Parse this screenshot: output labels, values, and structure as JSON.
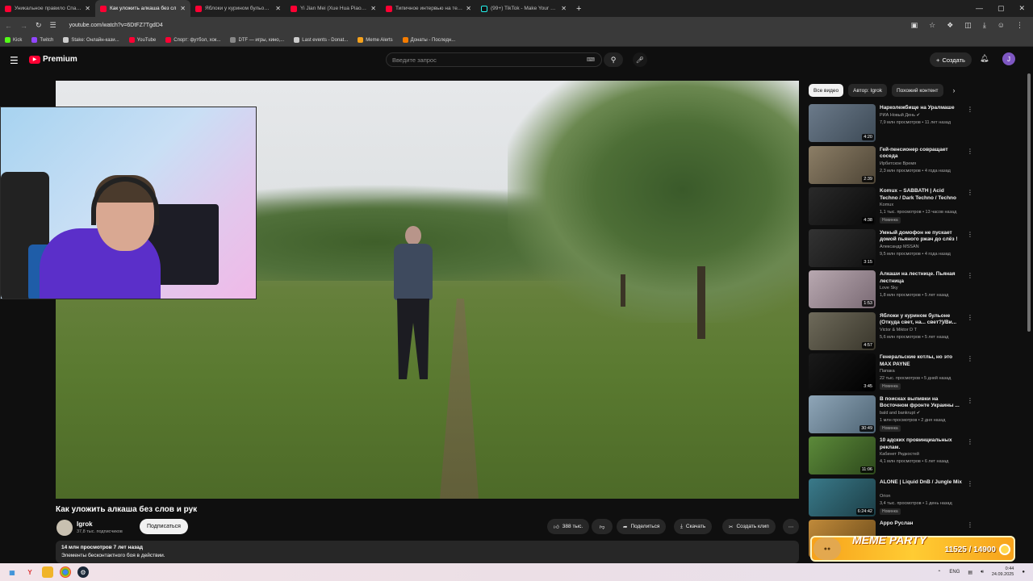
{
  "browser": {
    "tabs": [
      {
        "title": "Уникальное правило Спанч Б",
        "active": false,
        "icon": "youtube"
      },
      {
        "title": "Как уложить алкаша без сл",
        "active": true,
        "icon": "youtube"
      },
      {
        "title": "Яблоки у курином бульоне (О",
        "active": false,
        "icon": "youtube"
      },
      {
        "title": "Yi Jian Mei (Xue Hua Piao Piao)",
        "active": false,
        "icon": "youtube"
      },
      {
        "title": "Типичное интервью на телеви",
        "active": false,
        "icon": "youtube"
      },
      {
        "title": "(99+) TikTok - Make Your Day",
        "active": false,
        "icon": "tiktok"
      }
    ],
    "new_tab": "+",
    "url": "youtube.com/watch?v=6DtFZ7TgdD4",
    "bookmarks": [
      {
        "label": "Kick",
        "color": "#53fc18"
      },
      {
        "label": "Twitch",
        "color": "#9146ff"
      },
      {
        "label": "Stake: Онлайн-кази...",
        "color": "#cccccc"
      },
      {
        "label": "YouTube",
        "color": "#ff0033"
      },
      {
        "label": "Спорт: футбол, хок...",
        "color": "#ff0033"
      },
      {
        "label": "DTF — игры, кино,...",
        "color": "#888888"
      },
      {
        "label": "Last events - Donat...",
        "color": "#cccccc"
      },
      {
        "label": "Meme Alerts",
        "color": "#f7a21b"
      },
      {
        "label": "Донаты - Последн...",
        "color": "#f57c00"
      }
    ]
  },
  "header": {
    "logo_text": "Premium",
    "search_placeholder": "Введите запрос",
    "create_label": "Создать",
    "avatar_letter": "J"
  },
  "video": {
    "title": "Как уложить алкаша без слов и рук",
    "channel": "Igrok",
    "subscribers": "37,8 тыс. подписчиков",
    "subscribe_label": "Подписаться",
    "likes": "388 тыс.",
    "share_label": "Поделиться",
    "download_label": "Скачать",
    "clip_label": "Создать клип",
    "stats": "14 млн просмотров  7 лет назад",
    "description": "Элементы бесконтактного боя в действии."
  },
  "chips": [
    "Все видео",
    "Автор: Igrok",
    "Похожий контент"
  ],
  "recommendations": [
    {
      "title": "Нарколежбище на Уралмаше",
      "channel": "РИА Новый День",
      "verified": true,
      "meta": "7,9 млн просмотров • 11 лет назад",
      "duration": "4:20",
      "badge": "",
      "c1": "#6b7a8a",
      "c2": "#3d4a56"
    },
    {
      "title": "Гей-пенсионер совращает соседа",
      "channel": "Ирбитское Время",
      "verified": false,
      "meta": "2,3 млн просмотров • 4 года назад",
      "duration": "2:39",
      "badge": "",
      "c1": "#8c7e66",
      "c2": "#4e4536"
    },
    {
      "title": "Komux – SABBATH | Acid Techno / Dark Techno / Techno",
      "channel": "Komux",
      "verified": false,
      "meta": "1,1 тыс. просмотров • 13 часов назад",
      "duration": "4:38",
      "badge": "Новинка",
      "c1": "#2a2a2a",
      "c2": "#0a0a0a"
    },
    {
      "title": "Умный домофон не пускает домой пьяного ржач до слёз !",
      "channel": "Александр MSSAN",
      "verified": false,
      "meta": "9,5 млн просмотров • 4 года назад",
      "duration": "3:15",
      "badge": "",
      "c1": "#333333",
      "c2": "#111111"
    },
    {
      "title": "Алкаши на лестнице. Пьяная лестница",
      "channel": "Love Sky",
      "verified": false,
      "meta": "1,8 млн просмотров • 5 лет назад",
      "duration": "1:53",
      "badge": "",
      "c1": "#b8a8b0",
      "c2": "#7a6a74"
    },
    {
      "title": "Яблоки у курином бульоне (Откуда свет, на... свет?)/Ви...",
      "channel": "Victor & Miktor D T",
      "verified": false,
      "meta": "5,6 млн просмотров • 5 лет назад",
      "duration": "4:57",
      "badge": "",
      "c1": "#6e6a5a",
      "c2": "#3a372c"
    },
    {
      "title": "Генеральские котлы, но это MAX PAYNE",
      "channel": "Папака",
      "verified": false,
      "meta": "22 тыс. просмотров • 5 дней назад",
      "duration": "3:45",
      "badge": "Новинка",
      "c1": "#1a1a1a",
      "c2": "#000000"
    },
    {
      "title": "В поисках выпивки на Восточном фронте Украины ...",
      "channel": "bald and bankrupt",
      "verified": true,
      "meta": "1 млн просмотров • 2 дня назад",
      "duration": "30:49",
      "badge": "Новинка",
      "c1": "#8fa6b8",
      "c2": "#4e6474"
    },
    {
      "title": "10 адских провинциальных реклам.",
      "channel": "Кабинет Редкостей",
      "verified": false,
      "meta": "4,1 млн просмотров • 6 лет назад",
      "duration": "11:06",
      "badge": "",
      "c1": "#5c8a3a",
      "c2": "#2e4a1c"
    },
    {
      "title": "ALONE | Liquid DnB / Jungle Mix",
      "channel": "Orion",
      "verified": false,
      "meta": "3,4 тыс. просмотров • 1 день назад",
      "duration": "6:24:42",
      "badge": "Новинка",
      "c1": "#3a7a8a",
      "c2": "#1c3e46"
    },
    {
      "title": "Арро Руслан",
      "channel": "",
      "verified": false,
      "meta": "",
      "duration": "",
      "badge": "",
      "c1": "#c08a3a",
      "c2": "#6a4a1a"
    }
  ],
  "meme_party": {
    "title": "MEME PARTY",
    "score": "11525 / 14900"
  },
  "taskbar": {
    "lang": "ENG",
    "time": "0:44",
    "date": "24.09.2025"
  }
}
